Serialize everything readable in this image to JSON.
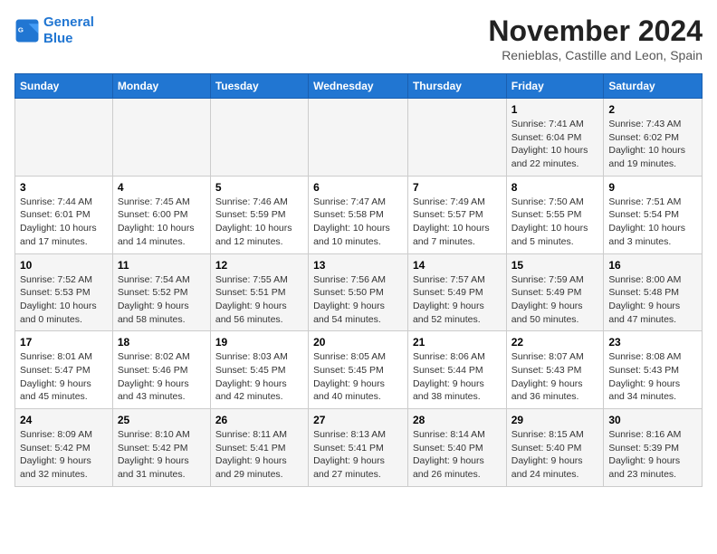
{
  "logo": {
    "line1": "General",
    "line2": "Blue"
  },
  "header": {
    "month": "November 2024",
    "location": "Renieblas, Castille and Leon, Spain"
  },
  "weekdays": [
    "Sunday",
    "Monday",
    "Tuesday",
    "Wednesday",
    "Thursday",
    "Friday",
    "Saturday"
  ],
  "weeks": [
    [
      {
        "day": "",
        "info": ""
      },
      {
        "day": "",
        "info": ""
      },
      {
        "day": "",
        "info": ""
      },
      {
        "day": "",
        "info": ""
      },
      {
        "day": "",
        "info": ""
      },
      {
        "day": "1",
        "info": "Sunrise: 7:41 AM\nSunset: 6:04 PM\nDaylight: 10 hours and 22 minutes."
      },
      {
        "day": "2",
        "info": "Sunrise: 7:43 AM\nSunset: 6:02 PM\nDaylight: 10 hours and 19 minutes."
      }
    ],
    [
      {
        "day": "3",
        "info": "Sunrise: 7:44 AM\nSunset: 6:01 PM\nDaylight: 10 hours and 17 minutes."
      },
      {
        "day": "4",
        "info": "Sunrise: 7:45 AM\nSunset: 6:00 PM\nDaylight: 10 hours and 14 minutes."
      },
      {
        "day": "5",
        "info": "Sunrise: 7:46 AM\nSunset: 5:59 PM\nDaylight: 10 hours and 12 minutes."
      },
      {
        "day": "6",
        "info": "Sunrise: 7:47 AM\nSunset: 5:58 PM\nDaylight: 10 hours and 10 minutes."
      },
      {
        "day": "7",
        "info": "Sunrise: 7:49 AM\nSunset: 5:57 PM\nDaylight: 10 hours and 7 minutes."
      },
      {
        "day": "8",
        "info": "Sunrise: 7:50 AM\nSunset: 5:55 PM\nDaylight: 10 hours and 5 minutes."
      },
      {
        "day": "9",
        "info": "Sunrise: 7:51 AM\nSunset: 5:54 PM\nDaylight: 10 hours and 3 minutes."
      }
    ],
    [
      {
        "day": "10",
        "info": "Sunrise: 7:52 AM\nSunset: 5:53 PM\nDaylight: 10 hours and 0 minutes."
      },
      {
        "day": "11",
        "info": "Sunrise: 7:54 AM\nSunset: 5:52 PM\nDaylight: 9 hours and 58 minutes."
      },
      {
        "day": "12",
        "info": "Sunrise: 7:55 AM\nSunset: 5:51 PM\nDaylight: 9 hours and 56 minutes."
      },
      {
        "day": "13",
        "info": "Sunrise: 7:56 AM\nSunset: 5:50 PM\nDaylight: 9 hours and 54 minutes."
      },
      {
        "day": "14",
        "info": "Sunrise: 7:57 AM\nSunset: 5:49 PM\nDaylight: 9 hours and 52 minutes."
      },
      {
        "day": "15",
        "info": "Sunrise: 7:59 AM\nSunset: 5:49 PM\nDaylight: 9 hours and 50 minutes."
      },
      {
        "day": "16",
        "info": "Sunrise: 8:00 AM\nSunset: 5:48 PM\nDaylight: 9 hours and 47 minutes."
      }
    ],
    [
      {
        "day": "17",
        "info": "Sunrise: 8:01 AM\nSunset: 5:47 PM\nDaylight: 9 hours and 45 minutes."
      },
      {
        "day": "18",
        "info": "Sunrise: 8:02 AM\nSunset: 5:46 PM\nDaylight: 9 hours and 43 minutes."
      },
      {
        "day": "19",
        "info": "Sunrise: 8:03 AM\nSunset: 5:45 PM\nDaylight: 9 hours and 42 minutes."
      },
      {
        "day": "20",
        "info": "Sunrise: 8:05 AM\nSunset: 5:45 PM\nDaylight: 9 hours and 40 minutes."
      },
      {
        "day": "21",
        "info": "Sunrise: 8:06 AM\nSunset: 5:44 PM\nDaylight: 9 hours and 38 minutes."
      },
      {
        "day": "22",
        "info": "Sunrise: 8:07 AM\nSunset: 5:43 PM\nDaylight: 9 hours and 36 minutes."
      },
      {
        "day": "23",
        "info": "Sunrise: 8:08 AM\nSunset: 5:43 PM\nDaylight: 9 hours and 34 minutes."
      }
    ],
    [
      {
        "day": "24",
        "info": "Sunrise: 8:09 AM\nSunset: 5:42 PM\nDaylight: 9 hours and 32 minutes."
      },
      {
        "day": "25",
        "info": "Sunrise: 8:10 AM\nSunset: 5:42 PM\nDaylight: 9 hours and 31 minutes."
      },
      {
        "day": "26",
        "info": "Sunrise: 8:11 AM\nSunset: 5:41 PM\nDaylight: 9 hours and 29 minutes."
      },
      {
        "day": "27",
        "info": "Sunrise: 8:13 AM\nSunset: 5:41 PM\nDaylight: 9 hours and 27 minutes."
      },
      {
        "day": "28",
        "info": "Sunrise: 8:14 AM\nSunset: 5:40 PM\nDaylight: 9 hours and 26 minutes."
      },
      {
        "day": "29",
        "info": "Sunrise: 8:15 AM\nSunset: 5:40 PM\nDaylight: 9 hours and 24 minutes."
      },
      {
        "day": "30",
        "info": "Sunrise: 8:16 AM\nSunset: 5:39 PM\nDaylight: 9 hours and 23 minutes."
      }
    ]
  ]
}
